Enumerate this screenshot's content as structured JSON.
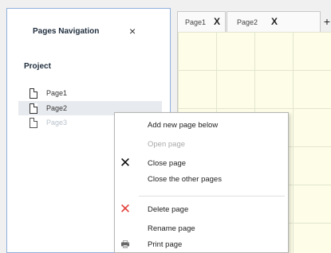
{
  "panel": {
    "title": "Pages Navigation",
    "close_icon": "×",
    "project_label": "Project",
    "items": [
      {
        "label": "Page1",
        "state": "normal"
      },
      {
        "label": "Page2",
        "state": "selected"
      },
      {
        "label": "Page3",
        "state": "dim"
      }
    ]
  },
  "tabs": {
    "items": [
      {
        "label": "Page1",
        "close": "X"
      },
      {
        "label": "Page2",
        "close": "X"
      }
    ],
    "add": "+"
  },
  "context_menu": {
    "items": [
      {
        "label": "Add new page below",
        "icon": ""
      },
      {
        "label": "Open page",
        "icon": "",
        "disabled": true
      },
      {
        "label": "Close page",
        "icon": "✕"
      },
      {
        "label": "Close the other pages",
        "icon": ""
      },
      {
        "label": "Delete page",
        "icon": "✕"
      },
      {
        "label": "Rename page",
        "icon": ""
      },
      {
        "label": "Print page",
        "icon": "🖶"
      }
    ]
  },
  "colors": {
    "panel_border": "#8fb0dc",
    "canvas_bg": "#fdfde8",
    "grid": "#e4e6cf",
    "delete_icon": "#e2403a",
    "close_icon": "#111111"
  }
}
